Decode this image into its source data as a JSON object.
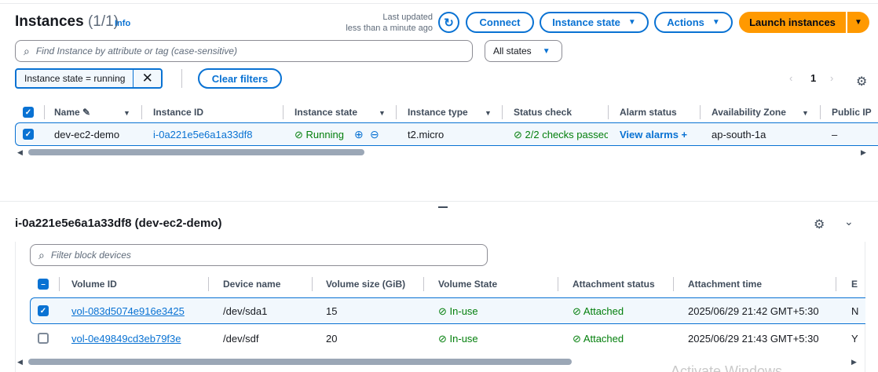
{
  "header": {
    "title": "Instances",
    "count": "(1/1)",
    "info": "Info",
    "last_updated_1": "Last updated",
    "last_updated_2": "less than a minute ago"
  },
  "toolbar": {
    "connect": "Connect",
    "instance_state": "Instance state",
    "actions": "Actions",
    "launch": "Launch instances"
  },
  "search": {
    "placeholder": "Find Instance by attribute or tag (case-sensitive)",
    "state_filter": "All states"
  },
  "filter": {
    "token": "Instance state = running",
    "clear": "Clear filters"
  },
  "pagination": {
    "page": "1"
  },
  "instances_table": {
    "headers": [
      "Name",
      "Instance ID",
      "Instance state",
      "Instance type",
      "Status check",
      "Alarm status",
      "Availability Zone",
      "Public IP"
    ],
    "rows": [
      {
        "name": "dev-ec2-demo",
        "id": "i-0a221e5e6a1a33df8",
        "state": "Running",
        "type": "t2.micro",
        "status": "2/2 checks passec",
        "alarm": "View alarms",
        "az": "ap-south-1a",
        "public_ip": "–"
      }
    ]
  },
  "detail": {
    "title": "i-0a221e5e6a1a33df8 (dev-ec2-demo)",
    "filter_placeholder": "Filter block devices",
    "headers": [
      "Volume ID",
      "Device name",
      "Volume size (GiB)",
      "Volume State",
      "Attachment status",
      "Attachment time",
      "E"
    ],
    "rows": [
      {
        "volume_id": "vol-083d5074e916e3425",
        "device": "/dev/sda1",
        "size": "15",
        "state": "In-use",
        "attachment": "Attached",
        "time": "2025/06/29 21:42 GMT+5:30",
        "extra": "N",
        "selected": true
      },
      {
        "volume_id": "vol-0e49849cd3eb79f3e",
        "device": "/dev/sdf",
        "size": "20",
        "state": "In-use",
        "attachment": "Attached",
        "time": "2025/06/29 21:43 GMT+5:30",
        "extra": "Y",
        "selected": false
      }
    ]
  },
  "watermark": "Activate Windows",
  "colors": {
    "accent": "#0972d3",
    "primary": "#ff9900",
    "success": "#037f0c"
  }
}
